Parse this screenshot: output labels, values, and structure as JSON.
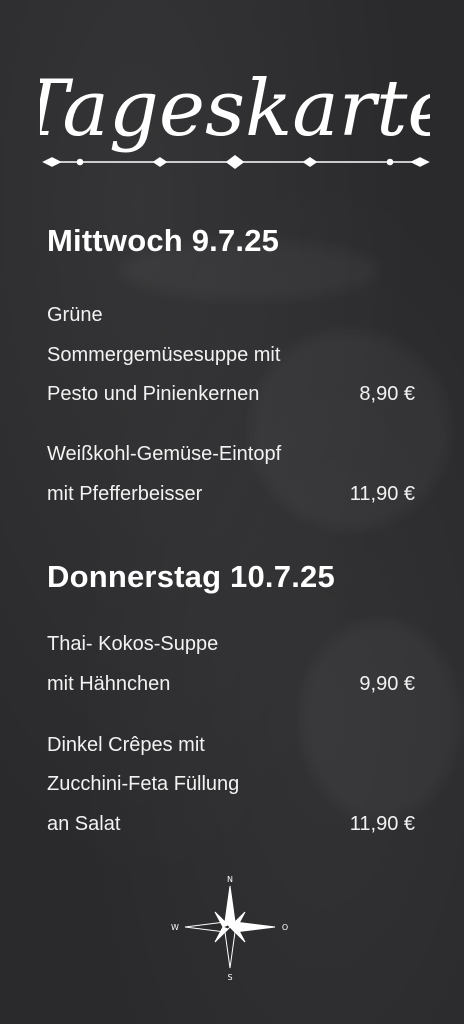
{
  "header": {
    "title": "Tageskarte"
  },
  "days": [
    {
      "heading": "Mittwoch 9.7.25",
      "items": [
        {
          "lines": [
            "Grüne",
            "Sommergemüsesuppe mit",
            "Pesto und Pinienkernen"
          ],
          "price": "8,90 €"
        },
        {
          "lines": [
            "Weißkohl-Gemüse-Eintopf",
            "mit Pfefferbeisser"
          ],
          "price": "11,90 €"
        }
      ]
    },
    {
      "heading": "Donnerstag 10.7.25",
      "items": [
        {
          "lines": [
            "Thai- Kokos-Suppe",
            "mit Hähnchen"
          ],
          "price": "9,90 €"
        },
        {
          "lines": [
            "Dinkel Crêpes mit",
            "Zucchini-Feta Füllung",
            "an Salat"
          ],
          "price": "11,90 €"
        }
      ]
    }
  ],
  "compass": {
    "north": "N",
    "south": "S",
    "west": "W",
    "east": "O"
  }
}
